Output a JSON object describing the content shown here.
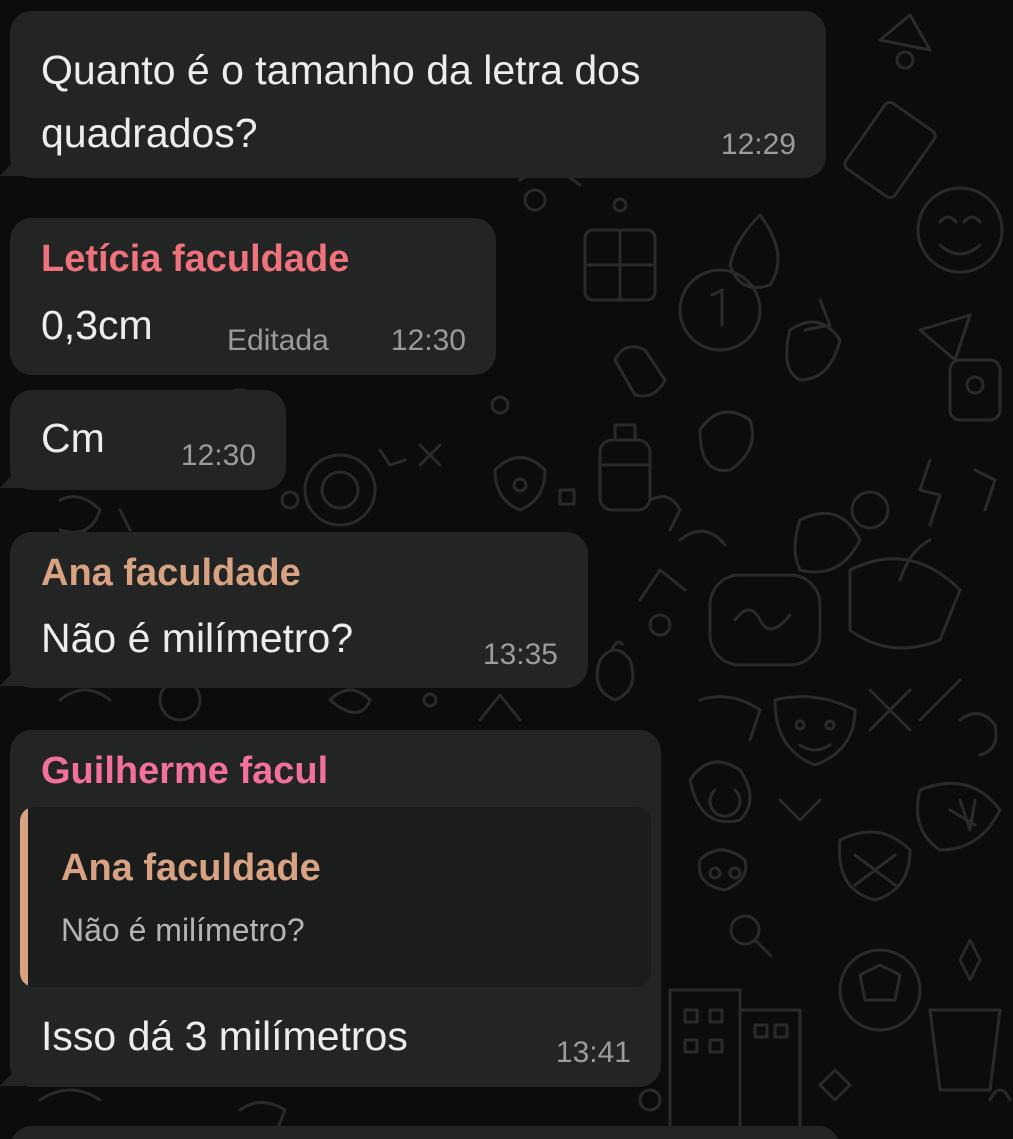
{
  "colors": {
    "bubble": "#232524",
    "quote_bg": "#1b1c1c",
    "leticia": "#f0727d",
    "ana": "#d9a283",
    "guilherme": "#f2709a",
    "timestamp": "#9a9c9b"
  },
  "messages": [
    {
      "text_line1": "Quanto é o tamanho da letra dos",
      "text_line2": "quadrados?",
      "time": "12:29"
    },
    {
      "sender": "Letícia faculdade",
      "text": "0,3cm",
      "edited": "Editada",
      "time": "12:30"
    },
    {
      "text": "Cm",
      "time": "12:30"
    },
    {
      "sender": "Ana faculdade",
      "text": "Não é milímetro?",
      "time": "13:35"
    },
    {
      "sender": "Guilherme facul",
      "quote": {
        "sender": "Ana faculdade",
        "text": "Não é milímetro?"
      },
      "text": "Isso dá 3 milímetros",
      "time": "13:41"
    }
  ]
}
